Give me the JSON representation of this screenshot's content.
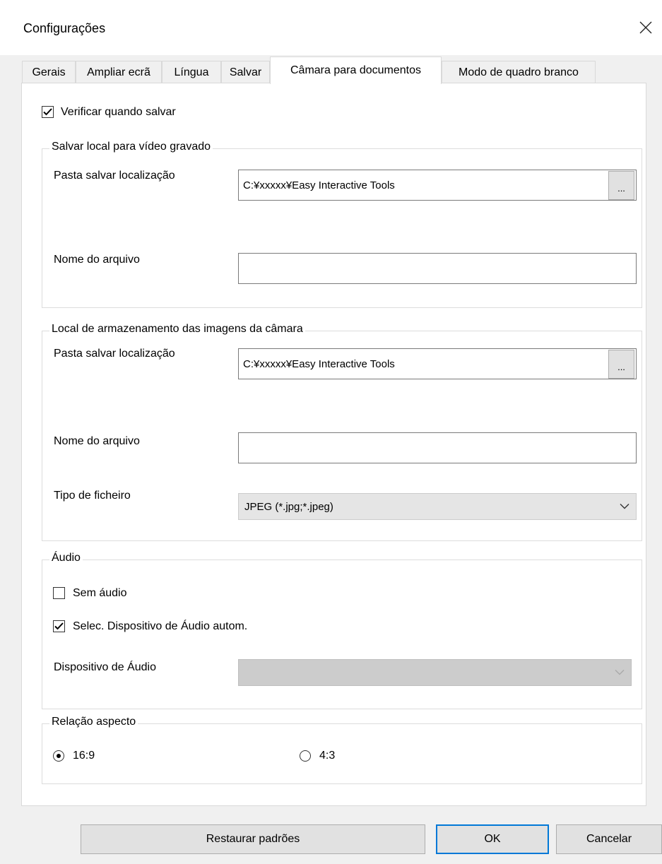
{
  "window": {
    "title": "Configurações",
    "close_icon": "close-icon"
  },
  "tabs": [
    {
      "label": "Gerais",
      "active": false
    },
    {
      "label": "Ampliar ecrã",
      "active": false
    },
    {
      "label": "Língua",
      "active": false
    },
    {
      "label": "Salvar",
      "active": false
    },
    {
      "label": "Câmara para documentos",
      "active": true
    },
    {
      "label": "Modo de quadro branco",
      "active": false
    }
  ],
  "verify_on_save": {
    "label": "Verificar quando salvar",
    "checked": true
  },
  "video_group": {
    "title": "Salvar local para vídeo gravado",
    "folder_label": "Pasta salvar localização",
    "folder_value": "C:¥xxxxx¥Easy Interactive Tools",
    "browse_label": "...",
    "filename_label": "Nome do arquivo",
    "filename_value": ""
  },
  "image_group": {
    "title": "Local de armazenamento das imagens da câmara",
    "folder_label": "Pasta salvar localização",
    "folder_value": "C:¥xxxxx¥Easy Interactive Tools",
    "browse_label": "...",
    "filename_label": "Nome do arquivo",
    "filename_value": "",
    "filetype_label": "Tipo de ficheiro",
    "filetype_value": "JPEG (*.jpg;*.jpeg)"
  },
  "audio_group": {
    "title": "Áudio",
    "no_audio": {
      "label": "Sem áudio",
      "checked": false
    },
    "auto_select": {
      "label": "Selec. Dispositivo de Áudio autom.",
      "checked": true
    },
    "device_label": "Dispositivo de Áudio",
    "device_value": ""
  },
  "aspect_group": {
    "title": "Relação aspecto",
    "option_169": {
      "label": "16:9",
      "selected": true
    },
    "option_43": {
      "label": "4:3",
      "selected": false
    }
  },
  "buttons": {
    "restore": "Restaurar padrões",
    "ok": "OK",
    "cancel": "Cancelar"
  }
}
